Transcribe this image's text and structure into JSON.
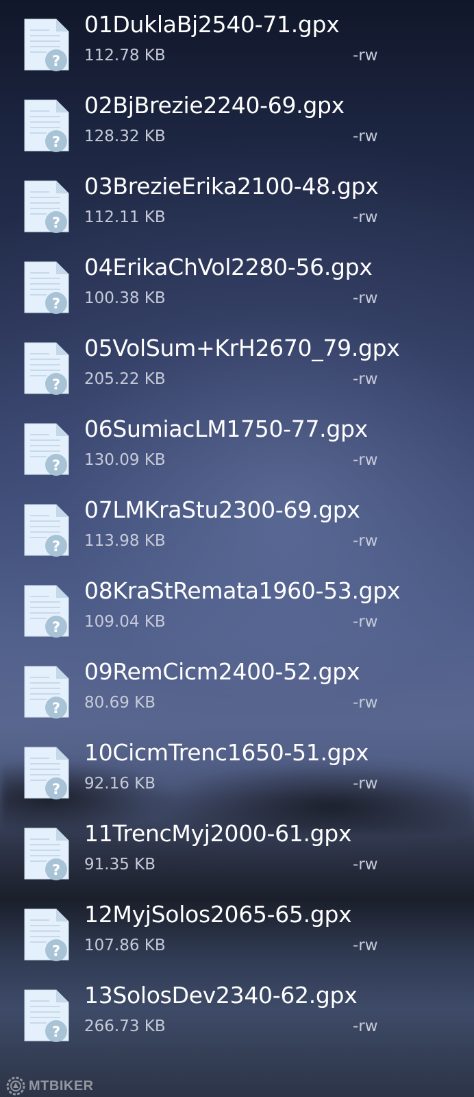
{
  "files": [
    {
      "name": "01DuklaBj2540-71.gpx",
      "size": "112.78 KB",
      "permissions": "-rw",
      "icon": "unknown-file-icon"
    },
    {
      "name": "02BjBrezie2240-69.gpx",
      "size": "128.32 KB",
      "permissions": "-rw",
      "icon": "unknown-file-icon"
    },
    {
      "name": "03BrezieErika2100-48.gpx",
      "size": "112.11 KB",
      "permissions": "-rw",
      "icon": "unknown-file-icon"
    },
    {
      "name": "04ErikaChVol2280-56.gpx",
      "size": "100.38 KB",
      "permissions": "-rw",
      "icon": "unknown-file-icon"
    },
    {
      "name": "05VolSum+KrH2670_79.gpx",
      "size": "205.22 KB",
      "permissions": "-rw",
      "icon": "unknown-file-icon"
    },
    {
      "name": "06SumiacLM1750-77.gpx",
      "size": "130.09 KB",
      "permissions": "-rw",
      "icon": "unknown-file-icon"
    },
    {
      "name": "07LMKraStu2300-69.gpx",
      "size": "113.98 KB",
      "permissions": "-rw",
      "icon": "unknown-file-icon"
    },
    {
      "name": "08KraStRemata1960-53.gpx",
      "size": "109.04 KB",
      "permissions": "-rw",
      "icon": "unknown-file-icon"
    },
    {
      "name": "09RemCicm2400-52.gpx",
      "size": "80.69 KB",
      "permissions": "-rw",
      "icon": "unknown-file-icon"
    },
    {
      "name": "10CicmTrenc1650-51.gpx",
      "size": "92.16 KB",
      "permissions": "-rw",
      "icon": "unknown-file-icon"
    },
    {
      "name": "11TrencMyj2000-61.gpx",
      "size": "91.35 KB",
      "permissions": "-rw",
      "icon": "unknown-file-icon"
    },
    {
      "name": "12MyjSolos2065-65.gpx",
      "size": "107.86 KB",
      "permissions": "-rw",
      "icon": "unknown-file-icon"
    },
    {
      "name": "13SolosDev2340-62.gpx",
      "size": "266.73 KB",
      "permissions": "-rw",
      "icon": "unknown-file-icon"
    }
  ],
  "watermark": {
    "text": "MTBIKER",
    "icon": "mtbiker-logo-icon"
  },
  "colors": {
    "file_name": "#ffffff",
    "file_meta": "#c7cbd8",
    "icon_page": "#e4f0fb",
    "icon_badge": "#a9c3d6"
  }
}
